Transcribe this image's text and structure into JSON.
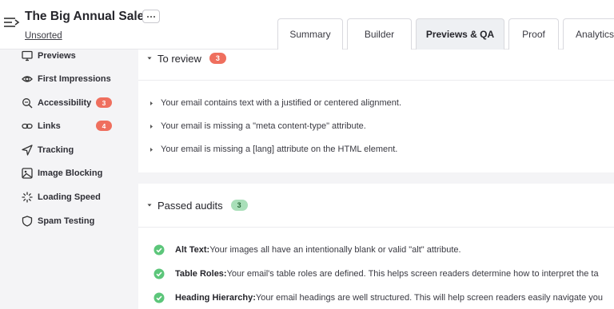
{
  "header": {
    "title": "The Big Annual Sale",
    "folder": "Unsorted",
    "menu_icon": "collapse-menu-icon",
    "more_icon": "more-options-icon"
  },
  "tabs": [
    {
      "label": "Summary",
      "active": false
    },
    {
      "label": "Builder",
      "active": false
    },
    {
      "label": "Previews & QA",
      "active": true
    },
    {
      "label": "Proof",
      "active": false
    },
    {
      "label": "Analytics",
      "active": false
    }
  ],
  "sidebar": {
    "items": [
      {
        "label": "Previews",
        "icon": "monitor-icon",
        "count": null
      },
      {
        "label": "First Impressions",
        "icon": "eye-icon",
        "count": null
      },
      {
        "label": "Accessibility",
        "icon": "magnifier-icon",
        "count": "3"
      },
      {
        "label": "Links",
        "icon": "link-icon",
        "count": "4"
      },
      {
        "label": "Tracking",
        "icon": "send-arrow-icon",
        "count": null
      },
      {
        "label": "Image Blocking",
        "icon": "image-icon",
        "count": null
      },
      {
        "label": "Loading Speed",
        "icon": "loading-icon",
        "count": null
      },
      {
        "label": "Spam Testing",
        "icon": "shield-icon",
        "count": null
      }
    ]
  },
  "review": {
    "title": "To review",
    "count": "3",
    "items": [
      "Your email contains text with a justified or centered alignment.",
      "Your email is missing a \"meta content-type\" attribute.",
      "Your email is missing a [lang] attribute on the HTML element."
    ]
  },
  "passed": {
    "title": "Passed audits",
    "count": "3",
    "items": [
      {
        "label": "Alt Text:",
        "desc": " Your images all have an intentionally blank or valid \"alt\" attribute."
      },
      {
        "label": "Table Roles:",
        "desc": " Your email's table roles are defined. This helps screen readers determine how to interpret the ta"
      },
      {
        "label": "Heading Hierarchy:",
        "desc": " Your email headings are well structured. This will help screen readers easily navigate you"
      }
    ]
  },
  "colors": {
    "badge_red": "#ef6f5e",
    "badge_green": "#a9dfb9",
    "check_green": "#5cc67a",
    "active_tab": "#eef0f3",
    "page_bg": "#f4f4f6"
  }
}
